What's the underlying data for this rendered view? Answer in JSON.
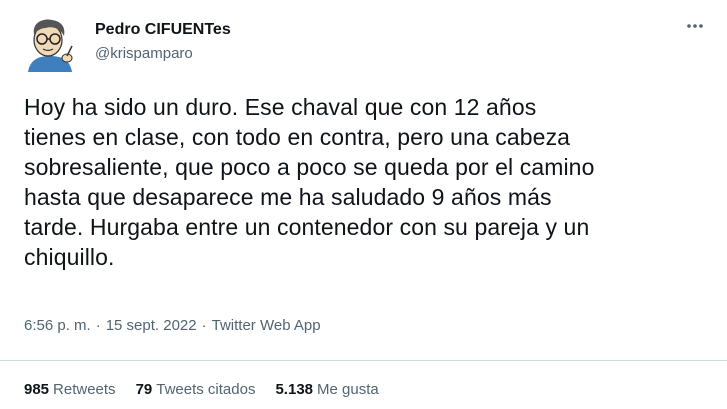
{
  "author": {
    "display_name": "Pedro CIFUENTes",
    "handle": "@krispamparo",
    "avatar_icon": "cartoon-avatar-icon"
  },
  "menu_icon": "more-horizontal-icon",
  "tweet": {
    "text_lines": [
      "Hoy ha sido un duro. Ese chaval que con 12 años",
      "tienes en clase, con todo en contra, pero una cabeza",
      "sobresaliente, que poco a poco se queda por el camino",
      "hasta que desaparece me ha saludado 9 años más",
      "tarde. Hurgaba entre un contenedor con su pareja y un",
      "chiquillo."
    ]
  },
  "meta": {
    "time": "6:56 p. m.",
    "separator": "·",
    "date": "15 sept. 2022",
    "source": "Twitter Web App"
  },
  "stats": {
    "retweets_count": "985",
    "retweets_label": "Retweets",
    "quotes_count": "79",
    "quotes_label": "Tweets citados",
    "likes_count": "5.138",
    "likes_label": "Me gusta"
  },
  "colors": {
    "text": "#0f1419",
    "secondary": "#536471",
    "divider": "#cfd9de"
  }
}
